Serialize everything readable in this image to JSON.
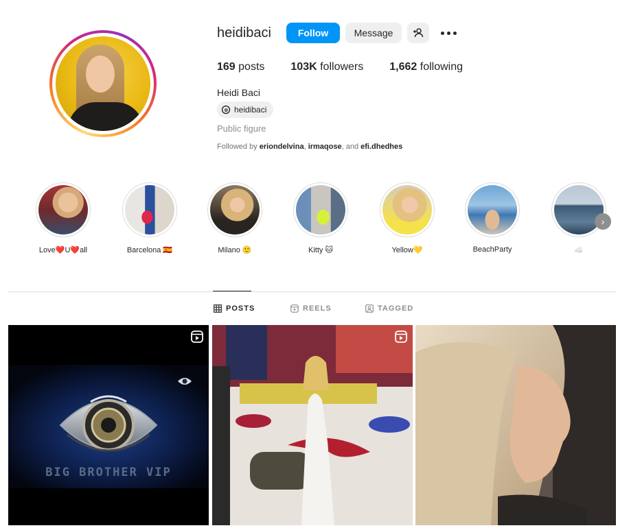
{
  "profile": {
    "username": "heidibaci",
    "full_name": "Heidi Baci",
    "threads_handle": "heidibaci",
    "category": "Public figure",
    "followed_by_prefix": "Followed by",
    "followed_by": [
      "eriondelvina",
      "irmaqose",
      "efi.dhedhes"
    ],
    "followed_by_sep1": ",",
    "followed_by_sep2": ", and"
  },
  "actions": {
    "follow": "Follow",
    "message": "Message"
  },
  "stats": {
    "posts_count": "169",
    "posts_label": "posts",
    "followers_count": "103K",
    "followers_label": "followers",
    "following_count": "1,662",
    "following_label": "following"
  },
  "highlights": [
    {
      "label": "Love❤️U❤️all"
    },
    {
      "label": "Barcelona 🇪🇸"
    },
    {
      "label": "Milano 🙂"
    },
    {
      "label": "Kitty 🐱"
    },
    {
      "label": "Yellow💛"
    },
    {
      "label": "BeachParty"
    },
    {
      "label": "☁️"
    }
  ],
  "tabs": [
    {
      "label": "POSTS",
      "active": true
    },
    {
      "label": "REELS",
      "active": false
    },
    {
      "label": "TAGGED",
      "active": false
    }
  ],
  "posts": [
    {
      "overlay_text": "BIG BROTHER VIP",
      "type": "reel"
    },
    {
      "overlay_text": "",
      "type": "reel"
    },
    {
      "overlay_text": "",
      "type": "image"
    }
  ],
  "colors": {
    "accent": "#0095f6",
    "text": "#262626",
    "muted": "#8e8e8e"
  }
}
